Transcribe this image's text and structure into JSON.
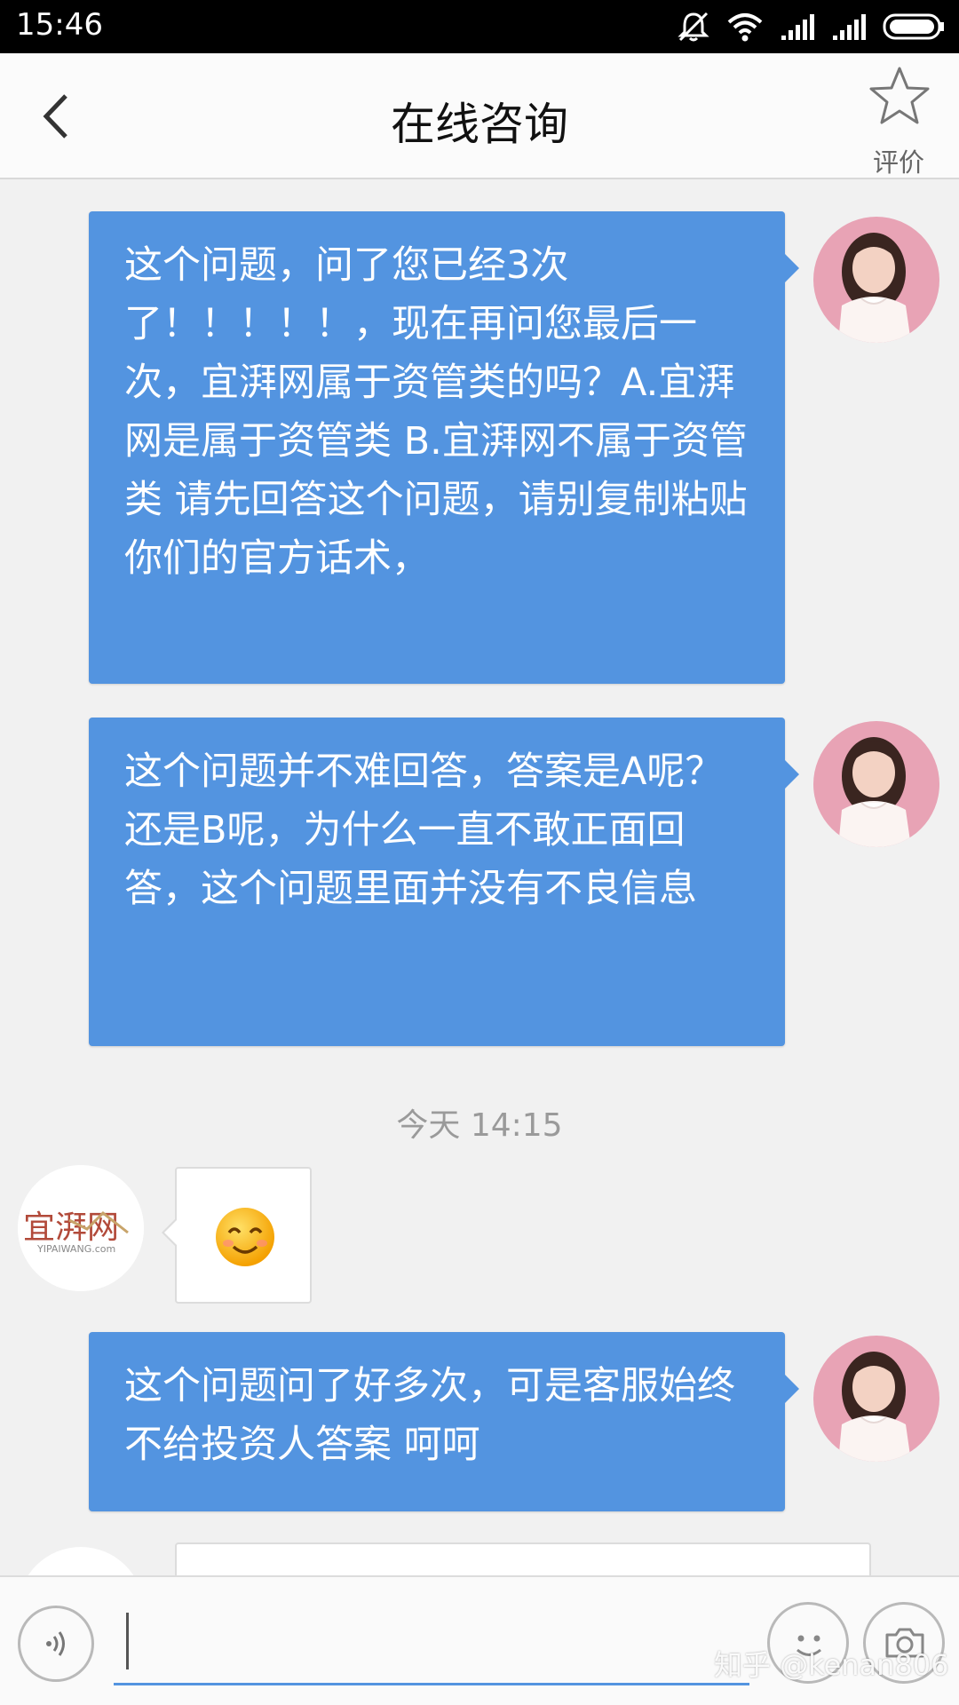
{
  "status_bar": {
    "time": "15:46"
  },
  "header": {
    "title": "在线咨询",
    "rate_label": "评价"
  },
  "messages": [
    {
      "side": "right",
      "text": "这个问题，问了您已经3次了！！！！！，现在再问您最后一次，宜湃网属于资管类的吗？A.宜湃网是属于资管类  B.宜湃网不属于资管类   请先回答这个问题，请别复制粘贴你们的官方话术，",
      "sender": "user"
    },
    {
      "side": "right",
      "text": "这个问题并不难回答，答案是A呢？  还是B呢，为什么一直不敢正面回答，这个问题里面并没有不良信息",
      "sender": "user"
    },
    {
      "side": "left",
      "emoji": "smile",
      "sender": "yipaiwang"
    },
    {
      "side": "right",
      "text": "这个问题问了好多次，可是客服始终不给投资人答案 呵呵",
      "sender": "user"
    }
  ],
  "timestamp": "今天 14:15",
  "agent_logo": {
    "text": "宜湃网",
    "subtext": "YIPAIWANG.com"
  },
  "input": {
    "value": "",
    "placeholder": ""
  },
  "watermark": "知乎 @kenan806",
  "colors": {
    "user_bubble": "#5394e0",
    "accent": "#5394e0",
    "background": "#f1f1f1"
  }
}
